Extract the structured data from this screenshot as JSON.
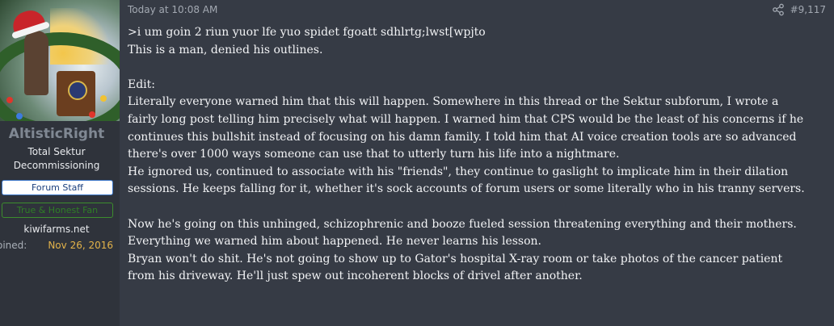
{
  "user": {
    "username": "AltisticRight",
    "title": "Total Sektur Decommissioning",
    "banner_staff": "Forum Staff",
    "banner_honest": "True & Honest Fan",
    "site": "kiwifarms.net",
    "joined_label": "oined:",
    "joined_value": "Nov 26, 2016"
  },
  "post": {
    "timestamp": "Today at 10:08 AM",
    "number": "#9,117",
    "lines": [
      ">i um goin 2 riun yuor lfe yuo spidet fgoatt sdhlrtg;lwst[wpjto",
      "This is a man, denied his outlines.",
      "",
      "Edit:",
      "Literally everyone warned him that this will happen. Somewhere in this thread or the Sektur subforum, I wrote a",
      "fairly long post telling him precisely what will happen. I warned him that CPS would be the least of his concerns if he",
      "continues this bullshit instead of focusing on his damn family. I told him that AI voice creation tools are so advanced",
      "there's over 1000 ways someone can use that to utterly turn his life into a nightmare.",
      "He ignored us, continued to associate with his \"friends\", they continue to gaslight to implicate him in their dilation",
      "sessions. He keeps falling for it, whether it's sock accounts of forum users or some literally who in his tranny servers.",
      "",
      "Now he's going on this unhinged, schizophrenic and booze fueled session threatening everything and their mothers.",
      "Everything we warned him about happened. He never learns his lesson.",
      "Bryan won't do shit. He's not going to show up to Gator's hospital X-ray room or take photos of the cancer patient",
      "from his driveway. He'll just spew out incoherent blocks of drivel after another."
    ]
  },
  "icons": {
    "share": "share-icon",
    "avatar": "avatar-image"
  },
  "colors": {
    "background": "#363b45",
    "sidebar": "#2f333b",
    "username": "#808893",
    "joined_value": "#e3b34a",
    "staff_border": "#3b76c8",
    "honest_border": "#3c8d2d"
  }
}
